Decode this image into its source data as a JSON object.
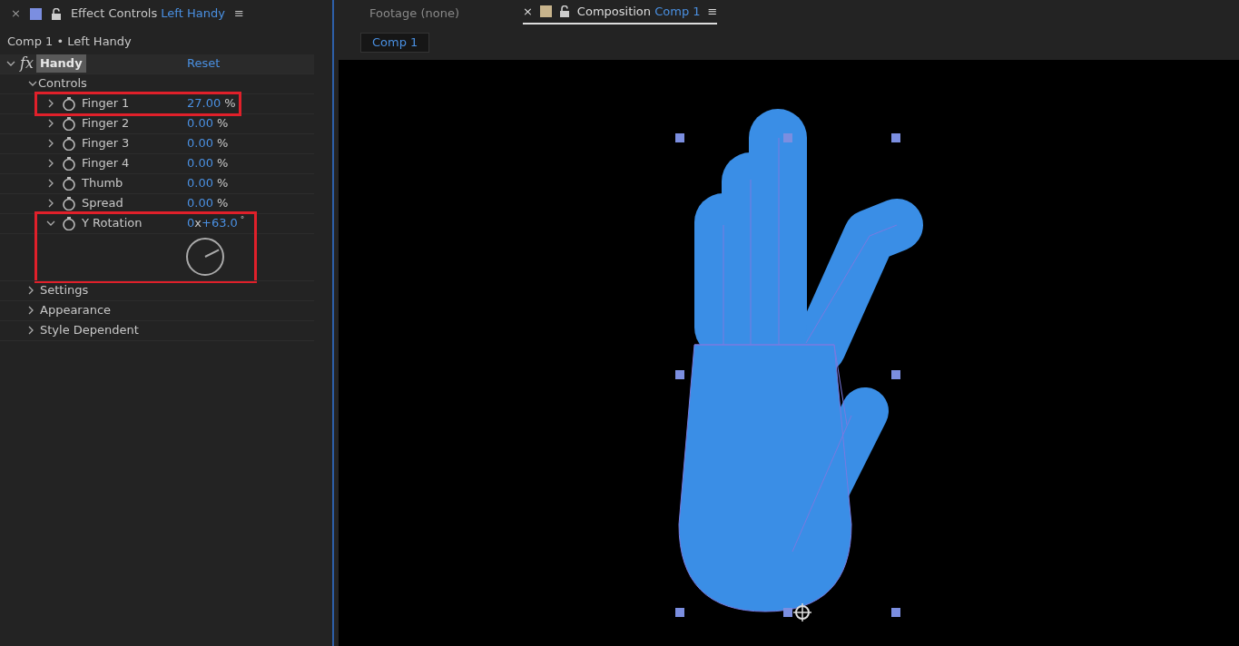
{
  "effect_panel": {
    "tab": {
      "close": "×",
      "title": "Effect Controls",
      "subject": "Left Handy",
      "color": "#7b8ee0",
      "menu": "≡"
    },
    "breadcrumb": "Comp 1 • Left Handy",
    "effect": {
      "icon": "fx",
      "name": "Handy",
      "reset": "Reset",
      "expanded": true
    },
    "controls": {
      "label": "Controls",
      "expanded": true,
      "children": [
        {
          "kind": "percent",
          "name": "Finger 1",
          "value": "27.00",
          "unit": "%",
          "expanded": false,
          "highlighted": true
        },
        {
          "kind": "percent",
          "name": "Finger 2",
          "value": "0.00",
          "unit": "%",
          "expanded": false,
          "highlighted": false
        },
        {
          "kind": "percent",
          "name": "Finger 3",
          "value": "0.00",
          "unit": "%",
          "expanded": false,
          "highlighted": false
        },
        {
          "kind": "percent",
          "name": "Finger 4",
          "value": "0.00",
          "unit": "%",
          "expanded": false,
          "highlighted": false
        },
        {
          "kind": "percent",
          "name": "Thumb",
          "value": "0.00",
          "unit": "%",
          "expanded": false,
          "highlighted": false
        },
        {
          "kind": "percent",
          "name": "Spread",
          "value": "0.00",
          "unit": "%",
          "expanded": false,
          "highlighted": false
        },
        {
          "kind": "angle",
          "name": "Y Rotation",
          "revolutions": "0",
          "times": "x",
          "value": "+63.0",
          "unit": "°",
          "expanded": true,
          "highlighted": true
        }
      ]
    },
    "groups": [
      {
        "label": "Settings",
        "expanded": false
      },
      {
        "label": "Appearance",
        "expanded": false
      },
      {
        "label": "Style Dependent",
        "expanded": false
      }
    ]
  },
  "composition_panel": {
    "tabs": [
      {
        "title": "Footage",
        "subject": "(none)",
        "selected": false
      },
      {
        "close": "×",
        "title": "Composition",
        "subject": "Comp 1",
        "color": "#c8b48c",
        "menu": "≡",
        "selected": true
      }
    ],
    "comp_tab": "Comp 1"
  }
}
